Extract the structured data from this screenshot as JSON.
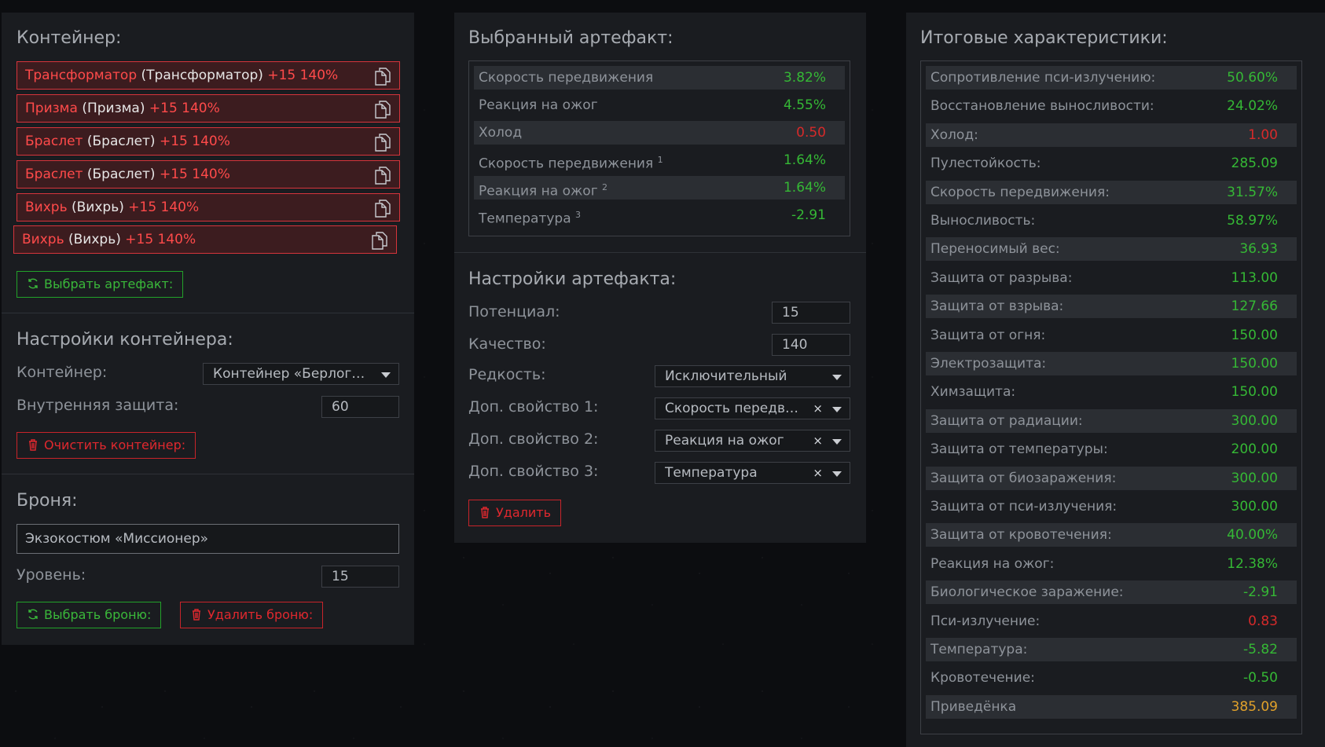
{
  "container_panel": {
    "title": "Контейнер:",
    "artifacts": [
      {
        "name": "Трансформатор",
        "type": "(Трансформатор)",
        "bonus": "+15 140%"
      },
      {
        "name": "Призма",
        "type": "(Призма)",
        "bonus": "+15 140%"
      },
      {
        "name": "Браслет",
        "type": "(Браслет)",
        "bonus": "+15 140%"
      },
      {
        "name": "Браслет",
        "type": "(Браслет)",
        "bonus": "+15 140%"
      },
      {
        "name": "Вихрь",
        "type": "(Вихрь)",
        "bonus": "+15 140%"
      },
      {
        "name": "Вихрь",
        "type": "(Вихрь)",
        "bonus": "+15 140%"
      }
    ],
    "select_artifact_label": "Выбрать артефакт:",
    "settings_title": "Настройки контейнера:",
    "container_label": "Контейнер:",
    "container_value": "Контейнер «Берлога…",
    "inner_protection_label": "Внутренняя защита:",
    "inner_protection_value": "60",
    "clear_label": "Очистить контейнер:",
    "armor_title": "Броня:",
    "armor_value": "Экзокостюм «Миссионер»",
    "level_label": "Уровень:",
    "level_value": "15",
    "select_armor_label": "Выбрать броню:",
    "delete_armor_label": "Удалить броню:"
  },
  "artifact_panel": {
    "title": "Выбранный артефакт:",
    "stats": [
      {
        "label": "Скорость передвижения",
        "sup": "",
        "value": "3.82%",
        "color": "green"
      },
      {
        "label": "Реакция на ожог",
        "sup": "",
        "value": "4.55%",
        "color": "green"
      },
      {
        "label": "Холод",
        "sup": "",
        "value": "0.50",
        "color": "red"
      },
      {
        "label": "Скорость передвижения",
        "sup": "1",
        "value": "1.64%",
        "color": "green"
      },
      {
        "label": "Реакция на ожог",
        "sup": "2",
        "value": "1.64%",
        "color": "green"
      },
      {
        "label": "Температура",
        "sup": "3",
        "value": "-2.91",
        "color": "green"
      }
    ],
    "settings_title": "Настройки артефакта:",
    "potential_label": "Потенциал:",
    "potential_value": "15",
    "quality_label": "Качество:",
    "quality_value": "140",
    "rarity_label": "Редкость:",
    "rarity_value": "Исключительный",
    "prop1_label": "Доп. свойство 1:",
    "prop1_value": "Скорость передви…",
    "prop2_label": "Доп. свойство 2:",
    "prop2_value": "Реакция на ожог",
    "prop3_label": "Доп. свойство 3:",
    "prop3_value": "Температура",
    "clear_glyph": "×",
    "delete_label": "Удалить"
  },
  "totals_panel": {
    "title": "Итоговые характеристики:",
    "stats": [
      {
        "label": "Сопротивление пси-излучению:",
        "value": "50.60%",
        "color": "green"
      },
      {
        "label": "Восстановление выносливости:",
        "value": "24.02%",
        "color": "green"
      },
      {
        "label": "Холод:",
        "value": "1.00",
        "color": "red"
      },
      {
        "label": "Пулестойкость:",
        "value": "285.09",
        "color": "green"
      },
      {
        "label": "Скорость передвижения:",
        "value": "31.57%",
        "color": "green"
      },
      {
        "label": "Выносливость:",
        "value": "58.97%",
        "color": "green"
      },
      {
        "label": "Переносимый вес:",
        "value": "36.93",
        "color": "green"
      },
      {
        "label": "Защита от разрыва:",
        "value": "113.00",
        "color": "green"
      },
      {
        "label": "Защита от взрыва:",
        "value": "127.66",
        "color": "green"
      },
      {
        "label": "Защита от огня:",
        "value": "150.00",
        "color": "green"
      },
      {
        "label": "Электрозащита:",
        "value": "150.00",
        "color": "green"
      },
      {
        "label": "Химзащита:",
        "value": "150.00",
        "color": "green"
      },
      {
        "label": "Защита от радиации:",
        "value": "300.00",
        "color": "green"
      },
      {
        "label": "Защита от температуры:",
        "value": "200.00",
        "color": "green"
      },
      {
        "label": "Защита от биозаражения:",
        "value": "300.00",
        "color": "green"
      },
      {
        "label": "Защита от пси-излучения:",
        "value": "300.00",
        "color": "green"
      },
      {
        "label": "Защита от кровотечения:",
        "value": "40.00%",
        "color": "green"
      },
      {
        "label": "Реакция на ожог:",
        "value": "12.38%",
        "color": "green"
      },
      {
        "label": "Биологическое заражение:",
        "value": "-2.91",
        "color": "green"
      },
      {
        "label": "Пси-излучение:",
        "value": "0.83",
        "color": "red"
      },
      {
        "label": "Температура:",
        "value": "-5.82",
        "color": "green"
      },
      {
        "label": "Кровотечение:",
        "value": "-0.50",
        "color": "green"
      },
      {
        "label": "Приведёнка",
        "value": "385.09",
        "color": "yellow"
      }
    ]
  }
}
